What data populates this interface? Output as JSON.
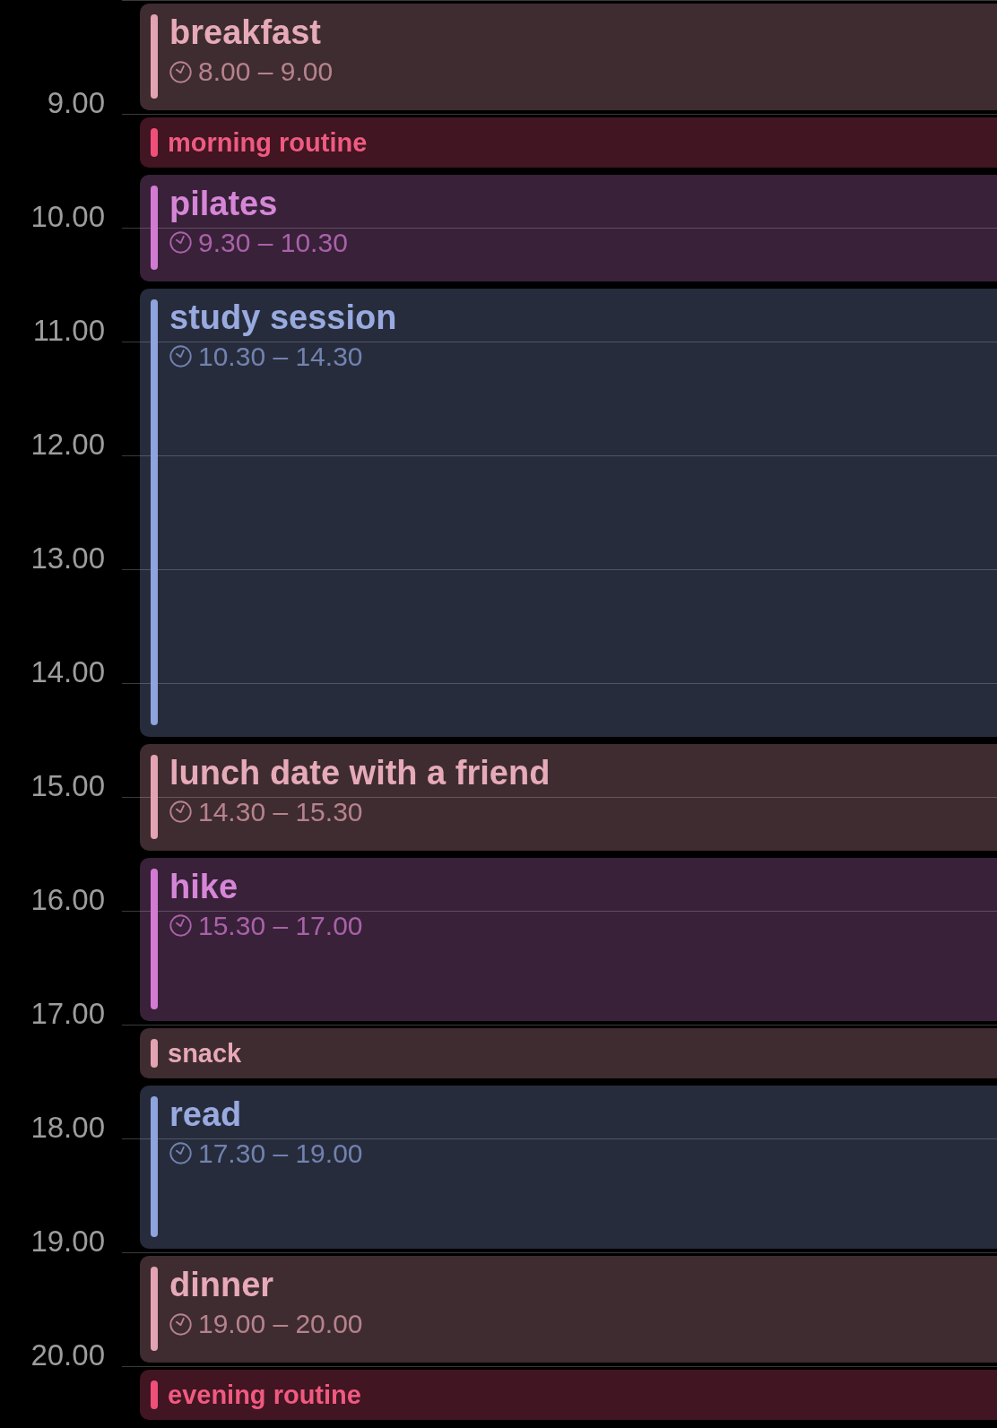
{
  "hours": [
    "9.00",
    "10.00",
    "11.00",
    "12.00",
    "13.00",
    "14.00",
    "15.00",
    "16.00",
    "17.00",
    "18.00",
    "19.00",
    "20.00"
  ],
  "events": [
    {
      "kind": "timed",
      "title": "breakfast",
      "time": "8.00 – 9.00",
      "color": "#e4a3b2"
    },
    {
      "kind": "brief",
      "title": "morning routine",
      "color": "#ef4f79"
    },
    {
      "kind": "timed",
      "title": "pilates",
      "time": "9.30 – 10.30",
      "color": "#d27bd3"
    },
    {
      "kind": "timed",
      "title": "study session",
      "time": "10.30 – 14.30",
      "color": "#8fa3dc"
    },
    {
      "kind": "timed",
      "title": "lunch date with a friend",
      "time": "14.30 – 15.30",
      "color": "#e4a3b2"
    },
    {
      "kind": "timed",
      "title": "hike",
      "time": "15.30 – 17.00",
      "color": "#d27bd3"
    },
    {
      "kind": "brief",
      "title": "snack",
      "color": "#e4a3b2"
    },
    {
      "kind": "timed",
      "title": "read",
      "time": "17.30 – 19.00",
      "color": "#8fa3dc"
    },
    {
      "kind": "timed",
      "title": "dinner",
      "time": "19.00 – 20.00",
      "color": "#e4a3b2"
    },
    {
      "kind": "brief",
      "title": "evening routine",
      "color": "#ef4f79"
    }
  ]
}
